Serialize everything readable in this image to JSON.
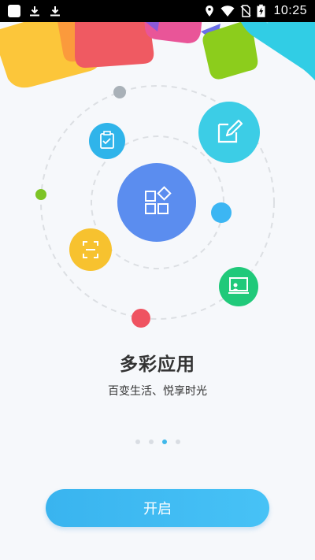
{
  "status_bar": {
    "time": "10:25",
    "icons": [
      "app-square-icon",
      "download-icon",
      "download-icon",
      "location-icon",
      "wifi-icon",
      "no-sim-icon",
      "battery-charging-icon"
    ]
  },
  "onboarding": {
    "title": "多彩应用",
    "subtitle": "百变生活、悦享时光",
    "page_count": 4,
    "active_page": 3,
    "start_label": "开启"
  },
  "colors": {
    "accent": "#40b8ea",
    "center_circle": "#5b8def",
    "edit_circle": "#3ccde6",
    "clipboard_circle": "#2fb4ea",
    "scan_circle": "#f7c22f",
    "presentation_circle": "#20c97a",
    "red_dot": "#ef5361",
    "green_dot": "#7dc425",
    "gray_dot": "#a9b1b8",
    "blue_dot": "#3cb6f3"
  }
}
